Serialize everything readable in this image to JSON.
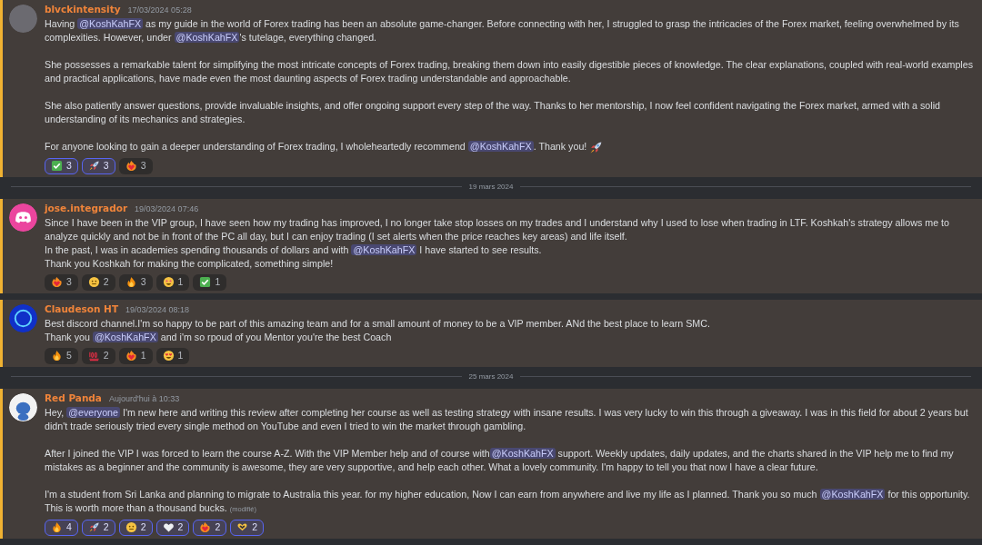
{
  "feed": [
    {
      "kind": "message",
      "author": "blvckintensity",
      "time": "17/03/2024 05:28",
      "avatar": {
        "kind": "photo"
      },
      "paragraphs": [
        [
          [
            {
              "kind": "text",
              "text": "Having "
            },
            {
              "kind": "mention",
              "text": "@KoshKahFX"
            },
            {
              "kind": "text",
              "text": " as my guide in the world of Forex trading has been an absolute game-changer. Before connecting with her, I struggled to grasp the intricacies of the Forex market, feeling overwhelmed by its complexities. However, under "
            },
            {
              "kind": "mention",
              "text": "@KoshKahFX"
            },
            {
              "kind": "text",
              "text": "'s tutelage, everything changed."
            }
          ]
        ],
        [
          [
            {
              "kind": "text",
              "text": "She possesses a remarkable talent for simplifying the most intricate concepts of Forex trading, breaking them down into easily digestible pieces of knowledge. The clear explanations, coupled with real-world examples and practical applications, have made even the most daunting aspects of Forex trading understandable and approachable."
            }
          ]
        ],
        [
          [
            {
              "kind": "text",
              "text": "She also patiently answer questions, provide invaluable insights, and offer ongoing support every step of the way. Thanks to her mentorship, I now feel confident navigating the Forex market, armed with a solid understanding of its mechanics and strategies."
            }
          ]
        ],
        [
          [
            {
              "kind": "text",
              "text": "For anyone looking to gain a deeper understanding of Forex trading, I wholeheartedly recommend "
            },
            {
              "kind": "mention",
              "text": "@KoshKahFX"
            },
            {
              "kind": "text",
              "text": ". Thank you! "
            },
            {
              "kind": "rocket"
            }
          ]
        ]
      ],
      "reactions": [
        {
          "kind": "check",
          "count": "3",
          "selected": true
        },
        {
          "kind": "rocket",
          "count": "3",
          "selected": true
        },
        {
          "kind": "heartfire",
          "count": "3",
          "selected": false
        }
      ]
    },
    {
      "kind": "divider",
      "date": "19 mars 2024"
    },
    {
      "kind": "message",
      "author": "jose.integrador",
      "time": "19/03/2024 07:46",
      "avatar": {
        "kind": "default"
      },
      "paragraphs": [
        [
          [
            {
              "kind": "text",
              "text": "Since I have been in the VIP group, I have seen how my trading has improved, I no longer take stop losses on my trades and I understand why I used to lose when trading in LTF. Koshkah's strategy allows me to analyze quickly and not be in front of the PC all day, but I can enjoy trading (I set alerts when the price reaches key areas) and life itself."
            }
          ],
          [
            {
              "kind": "text",
              "text": "In the past, I was in academies spending thousands of dollars and with "
            },
            {
              "kind": "mention",
              "text": "@KoshKahFX"
            },
            {
              "kind": "text",
              "text": "  I have started to see results."
            }
          ],
          [
            {
              "kind": "text",
              "text": "Thank you Koshkah for making the complicated, something simple!"
            }
          ]
        ]
      ],
      "reactions": [
        {
          "kind": "heartfire",
          "count": "3",
          "selected": false
        },
        {
          "kind": "face",
          "count": "2",
          "selected": false
        },
        {
          "kind": "fire",
          "count": "3",
          "selected": false
        },
        {
          "kind": "starface",
          "count": "1",
          "selected": false
        },
        {
          "kind": "check",
          "count": "1",
          "selected": false
        }
      ]
    },
    {
      "kind": "message",
      "author": "Claudeson HT",
      "time": "19/03/2024 08:18",
      "avatar": {
        "kind": "logo"
      },
      "paragraphs": [
        [
          [
            {
              "kind": "text",
              "text": "Best discord channel.I'm so happy to be part of this amazing team and for a small amount of money to be a VIP member. ANd the best place to learn SMC."
            }
          ],
          [
            {
              "kind": "text",
              "text": "Thank you "
            },
            {
              "kind": "mention",
              "text": "@KoshKahFX"
            },
            {
              "kind": "text",
              "text": " and i'm so rpoud of you Mentor you're the best Coach"
            }
          ]
        ]
      ],
      "reactions": [
        {
          "kind": "fire",
          "count": "5",
          "selected": false
        },
        {
          "kind": "hundred",
          "count": "2",
          "selected": false
        },
        {
          "kind": "heartfire",
          "count": "1",
          "selected": false
        },
        {
          "kind": "hearteyes",
          "count": "1",
          "selected": false
        }
      ]
    },
    {
      "kind": "divider",
      "date": "25 mars 2024"
    },
    {
      "kind": "message",
      "author": "Red Panda",
      "time": "Aujourd'hui à 10:33",
      "avatar": {
        "kind": "cartoon"
      },
      "paragraphs": [
        [
          [
            {
              "kind": "text",
              "text": "Hey, "
            },
            {
              "kind": "mention",
              "text": "@everyone"
            },
            {
              "kind": "text",
              "text": " I'm new here and writing this review after completing her course as well as testing strategy with insane results. I was very lucky to win this through a giveaway. I was in this field for about 2 years but didn't trade seriously tried every single method on YouTube and even I tried to win the market through gambling."
            }
          ]
        ],
        [
          [
            {
              "kind": "text",
              "text": "After I joined the VIP I was forced to learn the course A-Z. With the VIP Member help and of course with"
            },
            {
              "kind": "mention",
              "text": "@KoshKahFX"
            },
            {
              "kind": "text",
              "text": " support. Weekly updates, daily updates, and the charts shared in the VIP help me to find my mistakes as a beginner and the community is awesome, they are very supportive, and help each other. What a lovely community. I'm happy to tell you that now I have a clear future."
            }
          ]
        ],
        [
          [
            {
              "kind": "text",
              "text": "I'm a student from Sri Lanka and planning to migrate to Australia this year. for my higher education, Now I can earn from anywhere and live my life as I planned. Thank you so much "
            },
            {
              "kind": "mention",
              "text": "@KoshKahFX"
            },
            {
              "kind": "text",
              "text": " for this opportunity."
            }
          ],
          [
            {
              "kind": "text",
              "text": "This is worth more than a thousand bucks. "
            },
            {
              "kind": "edited",
              "text": "(modifié)"
            }
          ]
        ]
      ],
      "reactions": [
        {
          "kind": "fire",
          "count": "4",
          "selected": true
        },
        {
          "kind": "rocket",
          "count": "2",
          "selected": true
        },
        {
          "kind": "face",
          "count": "2",
          "selected": true
        },
        {
          "kind": "whiteheart",
          "count": "2",
          "selected": true
        },
        {
          "kind": "heartfire",
          "count": "2",
          "selected": true
        },
        {
          "kind": "hearthands",
          "count": "2",
          "selected": true
        }
      ]
    }
  ]
}
